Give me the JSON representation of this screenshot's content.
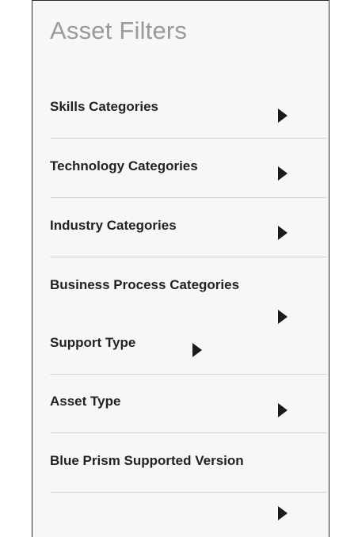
{
  "panel": {
    "title": "Asset Filters"
  },
  "filters": [
    {
      "label": "Skills Categories",
      "icon": "caret-right-icon"
    },
    {
      "label": "Technology Categories",
      "icon": "caret-right-icon"
    },
    {
      "label": "Industry Categories",
      "icon": "caret-right-icon"
    },
    {
      "label": "Business Process Categories",
      "icon": "caret-right-icon"
    },
    {
      "label": "Support Type",
      "icon": "caret-right-icon"
    },
    {
      "label": "Asset Type",
      "icon": "caret-right-icon"
    },
    {
      "label": "Blue Prism Supported Version",
      "icon": "caret-right-icon"
    }
  ],
  "colors": {
    "title": "#9a9a9a",
    "label": "#222222",
    "arrow": "#1c1c1c",
    "divider": "#d6d6d6",
    "panel_background": "#f7f7f7"
  }
}
